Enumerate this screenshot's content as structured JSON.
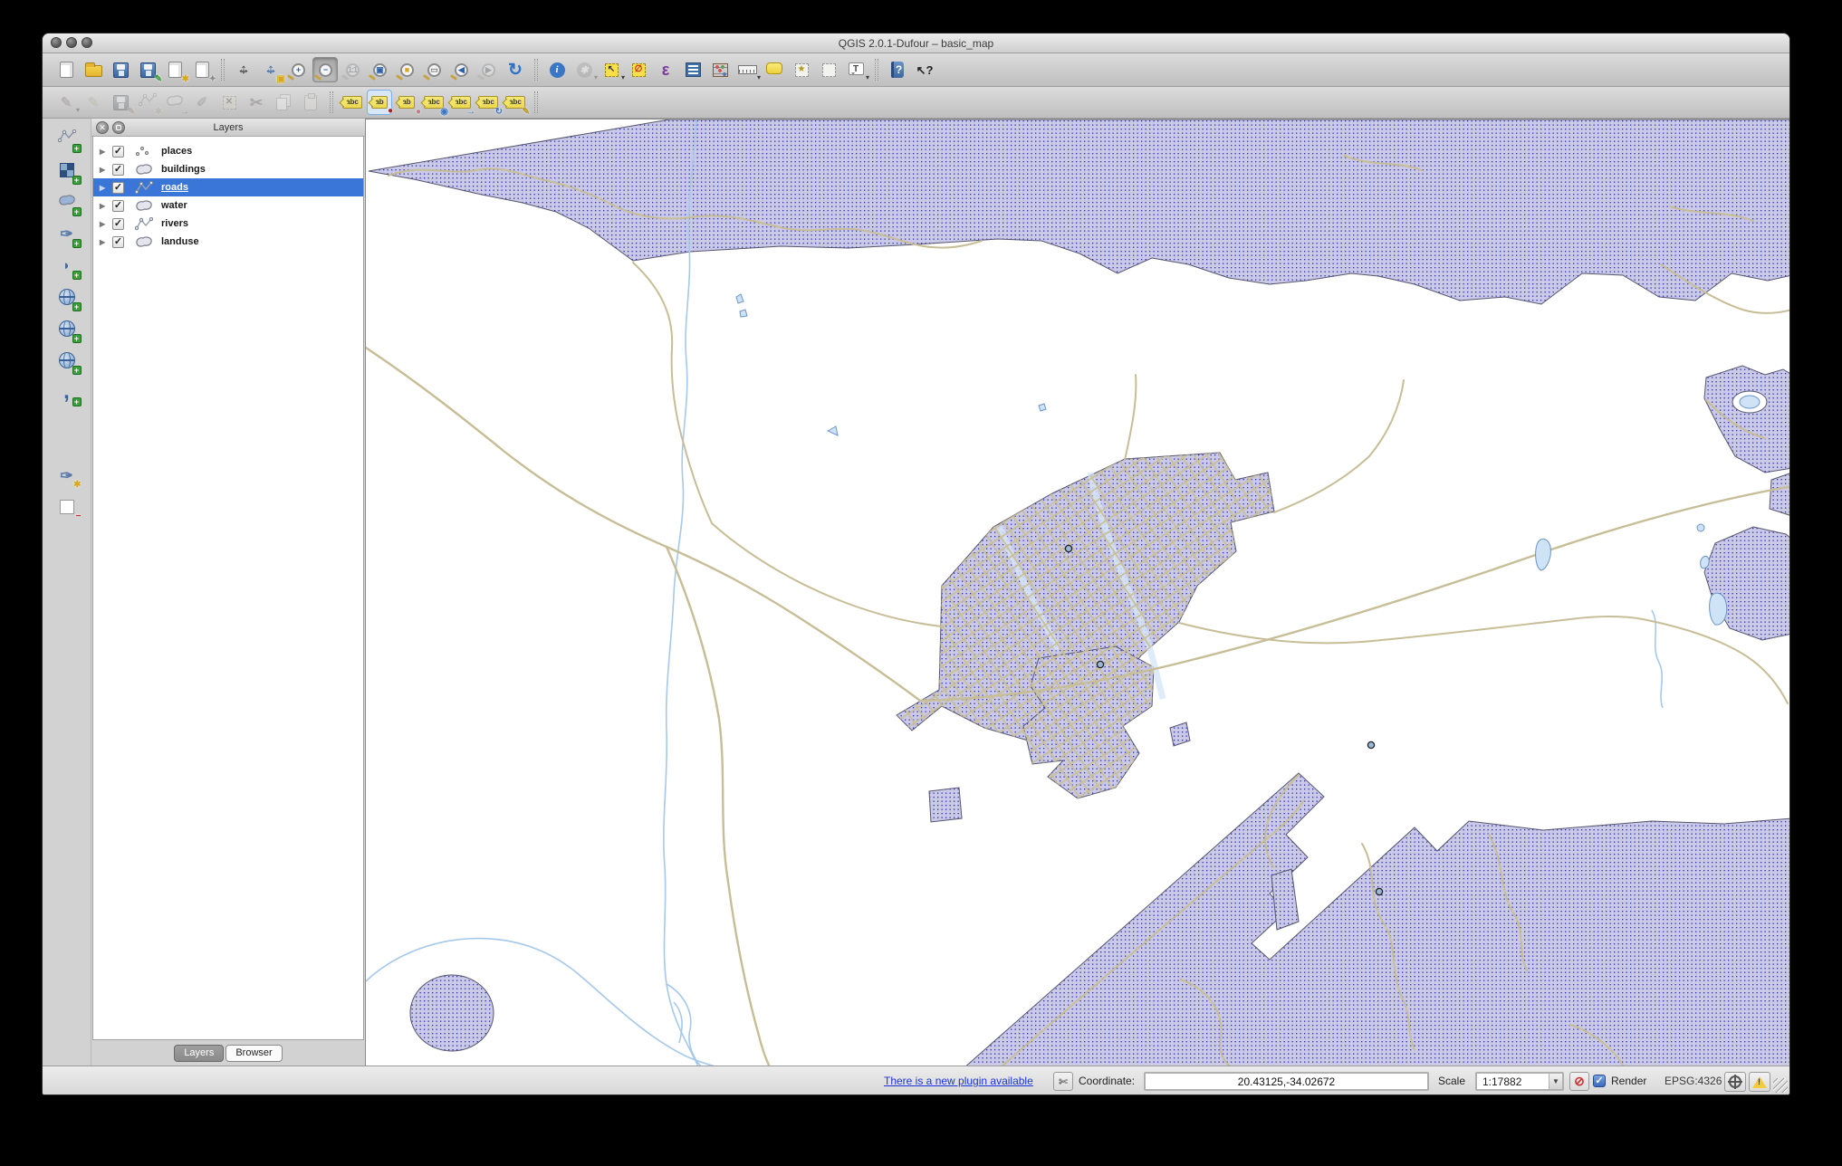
{
  "window": {
    "title": "QGIS 2.0.1-Dufour – basic_map"
  },
  "colors": {
    "selection": "#3a76d8",
    "landuse_fill": "#cacae8",
    "landuse_dot": "#2a2ab0",
    "landuse_stroke": "#55556e",
    "road": "#c7bd96",
    "river": "#a6c8ea",
    "water_fill": "#cfe3f7",
    "water_stroke": "#6a94c8",
    "accent_blue": "#2e62a8",
    "tag_yellow": "#f2e468"
  },
  "toolbars": {
    "main": {
      "items": [
        {
          "name": "new-project",
          "kind": "page"
        },
        {
          "name": "open-project",
          "kind": "folder"
        },
        {
          "name": "save-project",
          "kind": "floppy"
        },
        {
          "name": "save-project-as",
          "kind": "floppy",
          "badge": "✎",
          "badgeColor": "#3a9a3a"
        },
        {
          "name": "new-print-composer",
          "kind": "page",
          "badge": "✱",
          "badgeColor": "#d8a81a"
        },
        {
          "name": "composer-manager",
          "kind": "page",
          "badge": "✦",
          "badgeColor": "#8a8a8a"
        },
        {
          "sep": true
        },
        {
          "name": "pan-map",
          "kind": "overlay",
          "color": "#3a3a3a"
        },
        {
          "name": "pan-to-selection",
          "kind": "overlay",
          "color": "#2e62a8",
          "badge": "▣",
          "badgeColor": "#d8a81a"
        },
        {
          "name": "zoom-in",
          "kind": "mag",
          "glyph": "+"
        },
        {
          "name": "zoom-out",
          "kind": "mag",
          "glyph": "−",
          "active": true
        },
        {
          "name": "zoom-native",
          "kind": "mag",
          "glyph": "1:1",
          "disabled": true
        },
        {
          "name": "zoom-full-extent",
          "kind": "mag",
          "glyph": "▣",
          "glyphColor": "#2e62a8"
        },
        {
          "name": "zoom-to-selection",
          "kind": "mag",
          "glyph": "■",
          "glyphColor": "#d8a81a"
        },
        {
          "name": "zoom-to-layer",
          "kind": "mag",
          "glyph": "▭",
          "glyphColor": "#777777"
        },
        {
          "name": "zoom-last",
          "kind": "mag",
          "glyph": "◀",
          "glyphColor": "#2e62a8"
        },
        {
          "name": "zoom-next",
          "kind": "mag",
          "glyph": "▶",
          "disabled": true
        },
        {
          "name": "refresh-map",
          "kind": "glyph",
          "glyph": "↻",
          "color": "#2e72c8",
          "size": 19
        },
        {
          "sep": true
        },
        {
          "name": "identify-features",
          "kind": "disc",
          "glyph": "i",
          "bg": "#3a76c4"
        },
        {
          "name": "run-feature-action",
          "kind": "disc",
          "glyph": "✱",
          "bg": "#9a9a9a",
          "disabled": true,
          "dd": true
        },
        {
          "name": "select-features",
          "kind": "selbox",
          "glyph": "↖",
          "dd": true
        },
        {
          "name": "deselect-features",
          "kind": "selbox",
          "glyph": "∅",
          "glyphColor": "#cc2222"
        },
        {
          "name": "select-by-expression",
          "kind": "glyph",
          "glyph": "ε",
          "color": "#7a3a9a",
          "size": 18
        },
        {
          "name": "open-attribute-table",
          "kind": "table"
        },
        {
          "name": "field-calculator",
          "kind": "abacus"
        },
        {
          "name": "measure",
          "kind": "ruler",
          "dd": true
        },
        {
          "name": "map-tips",
          "kind": "bubble"
        },
        {
          "name": "new-bookmark",
          "kind": "dashbox",
          "glyph": "★",
          "glyphColor": "#b8961a"
        },
        {
          "name": "show-bookmarks",
          "kind": "dashbox"
        },
        {
          "name": "text-annotation",
          "kind": "tbubble",
          "glyph": "T",
          "dd": true
        },
        {
          "sep": true
        },
        {
          "name": "help-contents",
          "kind": "book",
          "glyph": "?"
        },
        {
          "name": "whats-this",
          "kind": "glyph",
          "glyph": "↖?",
          "color": "#222222",
          "size": 13
        }
      ]
    },
    "digitizing": {
      "items": [
        {
          "name": "current-edits",
          "kind": "glyph",
          "glyph": "✎",
          "color": "#c8762a",
          "dd": true,
          "disabled": true
        },
        {
          "name": "toggle-editing",
          "kind": "glyph",
          "glyph": "✎",
          "color": "#d8b21a",
          "disabled": true
        },
        {
          "name": "save-layer-edits",
          "kind": "floppy",
          "badge": "✎",
          "badgeColor": "#c8762a",
          "disabled": true
        },
        {
          "name": "add-feature",
          "kind": "svgline",
          "badge": "✱",
          "badgeColor": "#d8a81a",
          "disabled": true
        },
        {
          "name": "move-feature",
          "kind": "svgblob",
          "color": "#cfe0c8",
          "badge": "→",
          "badgeColor": "#2e62a8",
          "disabled": true
        },
        {
          "name": "node-tool",
          "kind": "glyph",
          "glyph": "✐",
          "color": "#8a8a8a",
          "disabled": true
        },
        {
          "name": "delete-selected",
          "kind": "selbox",
          "glyph": "✕",
          "glyphColor": "#cc2222",
          "disabled": true
        },
        {
          "name": "cut-features",
          "kind": "glyph",
          "glyph": "✂",
          "color": "#b04a4a",
          "size": 17,
          "disabled": true
        },
        {
          "name": "copy-features",
          "kind": "copy",
          "disabled": true
        },
        {
          "name": "paste-features",
          "kind": "clipboard",
          "disabled": true
        },
        {
          "sep": true
        },
        {
          "name": "labeling",
          "kind": "tag",
          "glyph": "abc"
        },
        {
          "name": "pin-unpin-labels",
          "kind": "tag",
          "glyph": "ab",
          "badge": "●",
          "badgeColor": "#b02020",
          "sel": true
        },
        {
          "name": "highlight-pinned-labels",
          "kind": "tag",
          "glyph": "ab",
          "badge": "●",
          "badgeColor": "#c87a8a"
        },
        {
          "name": "show-hide-labels",
          "kind": "tag",
          "glyph": "abc",
          "badge": "◉",
          "badgeColor": "#3a76c4"
        },
        {
          "name": "move-label",
          "kind": "tag",
          "glyph": "abc",
          "badge": "→",
          "badgeColor": "#3a76c4"
        },
        {
          "name": "rotate-label",
          "kind": "tag",
          "glyph": "abc",
          "badge": "↻",
          "badgeColor": "#3a76c4"
        },
        {
          "name": "change-label",
          "kind": "tag",
          "glyph": "abc",
          "badge": "✎",
          "badgeColor": "#b8961a"
        },
        {
          "sep": true
        }
      ]
    },
    "manage_layers": {
      "items": [
        {
          "name": "add-vector-layer",
          "kind": "svgline",
          "badge": "+"
        },
        {
          "name": "add-raster-layer",
          "kind": "raster",
          "badge": "+"
        },
        {
          "name": "add-postgis-layer",
          "kind": "svgblob",
          "color": "#9ab4d8",
          "badge": "+"
        },
        {
          "name": "add-spatialite-layer",
          "kind": "glyph",
          "glyph": "✑",
          "color": "#5a7aaa",
          "size": 17,
          "badge": "+"
        },
        {
          "name": "add-mssql-layer",
          "kind": "glyph",
          "glyph": "◗",
          "color": "#4a6a9a",
          "size": 15,
          "badge": "+"
        },
        {
          "name": "add-wms-layer",
          "kind": "globe",
          "badge": "+"
        },
        {
          "name": "add-wcs-layer",
          "kind": "globe",
          "badge": "+"
        },
        {
          "name": "add-wfs-layer",
          "kind": "globe",
          "badge": "+"
        },
        {
          "name": "add-delimited-text-layer",
          "kind": "glyph",
          "glyph": ",",
          "color": "#3a6296",
          "size": 24,
          "badge": "+"
        },
        {
          "gap": 50
        },
        {
          "name": "new-spatialite-layer",
          "kind": "glyph",
          "glyph": "✑",
          "color": "#5a7aaa",
          "size": 17,
          "badge": "✱",
          "badgeColor": "#d8a81a"
        },
        {
          "name": "remove-layer",
          "kind": "wbox",
          "badge": "−",
          "badgeColor": "#cc2222"
        }
      ]
    }
  },
  "layers_panel": {
    "title": "Layers",
    "close_glyph": "✕",
    "expand_glyph": "▶",
    "check_glyph": "✓",
    "layers": [
      {
        "label": "places",
        "type": "point",
        "checked": true,
        "selected": false
      },
      {
        "label": "buildings",
        "type": "polygon",
        "checked": true,
        "selected": false
      },
      {
        "label": "roads",
        "type": "line",
        "checked": true,
        "selected": true
      },
      {
        "label": "water",
        "type": "polygon",
        "checked": true,
        "selected": false
      },
      {
        "label": "rivers",
        "type": "line",
        "checked": true,
        "selected": false
      },
      {
        "label": "landuse",
        "type": "polygon",
        "checked": true,
        "selected": false
      }
    ],
    "tabs": [
      {
        "label": "Layers",
        "active": true
      },
      {
        "label": "Browser",
        "active": false
      }
    ]
  },
  "statusbar": {
    "plugin_link": "There is a new plugin available",
    "plugin_icon": "✄",
    "coordinate_label": "Coordinate:",
    "coordinate_value": "20.43125,-34.02672",
    "scale_label": "Scale",
    "scale_value": "1:17882",
    "combo_arrow": "▼",
    "maglock_glyph": "⊘",
    "render_label": "Render",
    "render_checked": true,
    "crs_label": "EPSG:4326"
  }
}
